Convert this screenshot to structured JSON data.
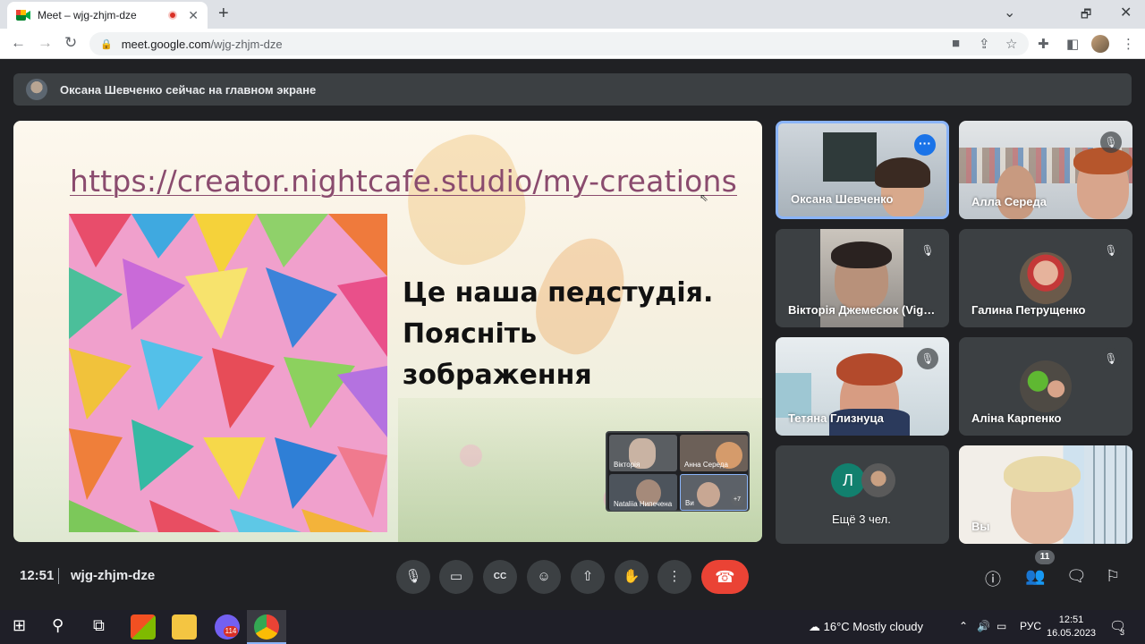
{
  "browser": {
    "tab_title": "Meet – wjg-zhjm-dze",
    "new_tab": "+",
    "url_host": "meet.google.com",
    "url_path": "/wjg-zhjm-dze",
    "window_controls": [
      "⌄",
      "🗗",
      "✕"
    ]
  },
  "banner": {
    "text": "Оксана Шевченко сейчас на главном экране"
  },
  "slide": {
    "link": "https://creator.nightcafe.studio/my-creations",
    "heading_lines": [
      "Це наша педстудія.",
      "Поясніть",
      "зображення"
    ],
    "mini_tiles": [
      {
        "name": "Вікторія"
      },
      {
        "name": "Анна Середа"
      },
      {
        "name": "Nataliia Нипечена"
      },
      {
        "name": "Ви"
      }
    ],
    "mini_more": "+7"
  },
  "participants": [
    {
      "name": "Оксана Шевченко",
      "state": "options",
      "active": true
    },
    {
      "name": "Алла Середа",
      "state": "muted"
    },
    {
      "name": "Вікторія Джемесюк (Vig…",
      "state": "muted"
    },
    {
      "name": "Галина Петрущенко",
      "state": "muted"
    },
    {
      "name": "Тетяна Глизнуца",
      "state": "muted"
    },
    {
      "name": "Аліна Карпенко",
      "state": "muted"
    },
    {
      "name": "Ещё 3 чел.",
      "initial": "Л"
    },
    {
      "name": "Вы"
    }
  ],
  "footer": {
    "time": "12:51",
    "meeting_code": "wjg-zhjm-dze",
    "participant_count": "11"
  },
  "taskbar": {
    "viber_badge": "114",
    "weather": "16°C  Mostly cloudy",
    "lang": "РУС",
    "time": "12:51",
    "date": "16.05.2023",
    "notif_count": "3"
  },
  "icons": {
    "mic": "mic-icon",
    "camera": "camera-icon",
    "captions": "captions-icon",
    "emoji": "emoji-icon",
    "present": "present-icon",
    "hand": "raise-hand-icon",
    "more": "more-vert-icon",
    "end": "end-call-icon",
    "info": "info-icon",
    "people": "people-icon",
    "chat": "chat-icon",
    "activities": "activities-icon"
  },
  "colors": {
    "end_call": "#ea4335",
    "active_border": "#8ab4f8",
    "link": "#8a4b6e"
  }
}
